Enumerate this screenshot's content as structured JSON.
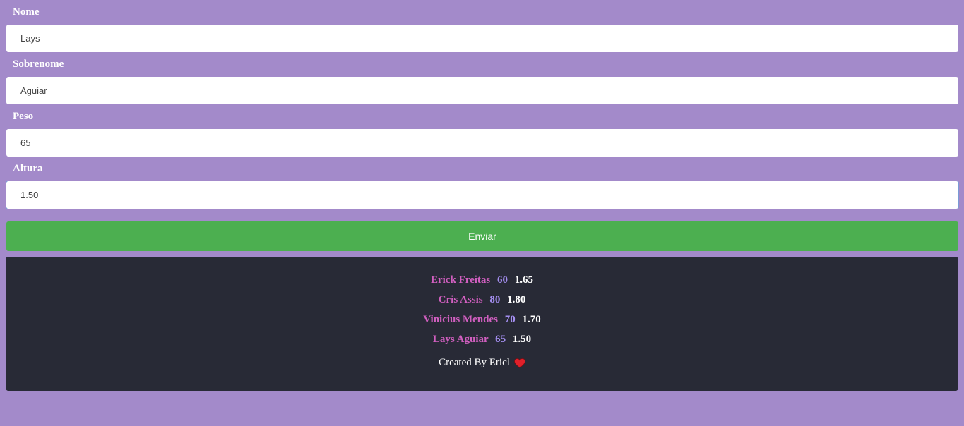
{
  "form": {
    "fields": [
      {
        "label": "Nome",
        "value": "Lays"
      },
      {
        "label": "Sobrenome",
        "value": "Aguiar"
      },
      {
        "label": "Peso",
        "value": "65"
      },
      {
        "label": "Altura",
        "value": "1.50"
      }
    ],
    "submit_label": "Enviar"
  },
  "results": {
    "rows": [
      {
        "name": "Erick Freitas",
        "weight": "60",
        "height": "1.65"
      },
      {
        "name": "Cris Assis",
        "weight": "80",
        "height": "1.80"
      },
      {
        "name": "Vinicius Mendes",
        "weight": "70",
        "height": "1.70"
      },
      {
        "name": "Lays Aguiar",
        "weight": "65",
        "height": "1.50"
      }
    ],
    "credit": "Created By Ericl",
    "credit_icon": "heart-icon"
  },
  "colors": {
    "background": "#a38aca",
    "submit": "#4caf50",
    "panel": "#282a36",
    "name": "#d15fc0",
    "weight": "#a48ef0"
  }
}
